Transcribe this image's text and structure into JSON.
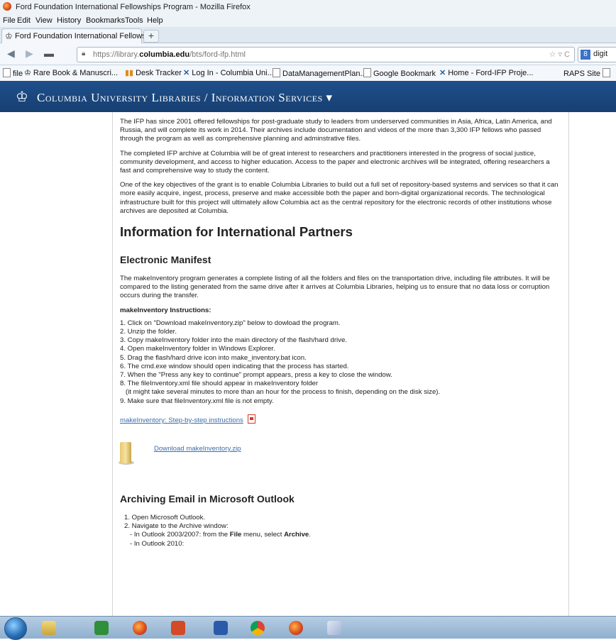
{
  "window": {
    "title": "Ford Foundation International Fellowships Program - Mozilla Firefox"
  },
  "menu": [
    "File",
    "Edit",
    "View",
    "History",
    "Bookmarks",
    "Tools",
    "Help"
  ],
  "tab": {
    "label": "Ford Foundation International Fellowshi...",
    "new_tab": "+"
  },
  "nav": {
    "url_prefix": "https://library.",
    "url_domain": "columbia.edu",
    "url_path": "/bts/ford-ifp.html",
    "search_text": "digit"
  },
  "bookmarks": [
    {
      "label": "file",
      "icon": "page-icon"
    },
    {
      "label": "Rare Book & Manuscri...",
      "icon": "crown-icon"
    },
    {
      "label": "Desk Tracker",
      "icon": "bars-icon"
    },
    {
      "label": "Log In - Columbia Uni...",
      "icon": "x-icon"
    },
    {
      "label": "DataManagementPlan...",
      "icon": "page-icon"
    },
    {
      "label": "Google Bookmark",
      "icon": "page-icon"
    },
    {
      "label": "Home - Ford-IFP Proje...",
      "icon": "x-icon"
    },
    {
      "label": "RAPS Site",
      "icon": "page-icon"
    }
  ],
  "site": {
    "name": "Columbia University Libraries / Information Services ▾"
  },
  "content": {
    "p1": "The IFP has since 2001 offered fellowships for post-graduate study to leaders from underserved communities in Asia, Africa, Latin America, and Russia, and will complete its work in 2014. Their archives include documentation and videos of the more than 3,300 IFP fellows who passed through the program as well as comprehensive planning and adminstrative files.",
    "p2": "The completed IFP archive at Columbia will be of great interest to researchers and practitioners interested in the progress of social justice, community development, and access to higher education. Access to the paper and electronic archives will be integrated, offering researchers a fast and comprehensive way to study the content.",
    "p3": "One of the key objectives of the grant is to enable Columbia Libraries to build out a full set of repository-based systems and services so that it can more easily acquire, ingest, process, preserve and make accessible both the paper and born-digital organizational records. The technological infrastructure built for this project will ultimately allow Columbia act as the central repository for the electronic records of other institutions whose archives are deposited at Columbia.",
    "h_partners": "Information for International Partners",
    "h_manifest": "Electronic Manifest",
    "p_manifest": "The makeInventory program generates a complete listing of all the folders and files on the transportation drive, including file attributes. It will be compared to the listing generated from the same drive after it arrives at Columbia Libraries, helping us to ensure that no data loss or corruption occurs during the transfer.",
    "instr_heading": "makeInventory Instructions:",
    "steps": [
      "1. Click on \"Download makeInventory.zip\" below to dowload the program.",
      "2. Unzip the folder.",
      "3. Copy makeInventory folder into the main directory of the flash/hard drive.",
      "4. Open makeInventory folder in Windows Explorer.",
      "5. Drag the flash/hard drive icon into make_inventory.bat icon.",
      "6. The cmd.exe window should open indicating that the process has started.",
      "7. When the \"Press any key to continue\" prompt appears, press a key to close the window.",
      "8. The fileInventory.xml file should appear in makeInventory folder",
      "   (it might take several minutes to more than an hour for the process to finish, depending on the disk size).",
      "9. Make sure that fileInventory.xml file is not empty."
    ],
    "step_link": "makeInventory: Step-by-step instructions",
    "download_link": "Download makeInventory.zip",
    "h_outlook": "Archiving Email in Microsoft Outlook",
    "outlook_1": "1.  Open Microsoft Outlook.",
    "outlook_2": "2.  Navigate to the Archive window:",
    "outlook_2a_pre": "- In Outlook 2003/2007: from the ",
    "outlook_2a_file": "File",
    "outlook_2a_mid": " menu, select ",
    "outlook_2a_archive": "Archive",
    "outlook_2a_end": ".",
    "outlook_2b": "- In Outlook 2010:"
  },
  "taskbar": [
    "start-orb",
    "explorer-icon",
    "excel-icon",
    "firefox-icon",
    "powerpoint-icon",
    "word-icon",
    "chrome-icon",
    "firefox-icon",
    "paint-icon"
  ]
}
